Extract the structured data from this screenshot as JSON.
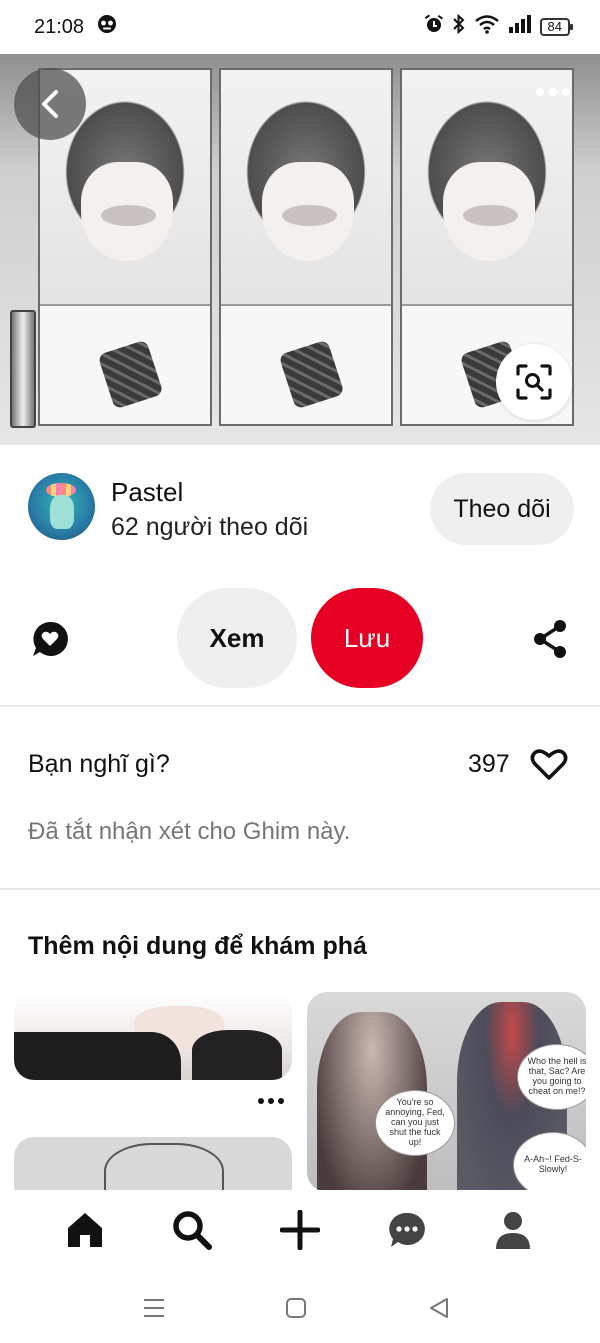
{
  "status_bar": {
    "time": "21:08",
    "battery": "84"
  },
  "creator": {
    "name": "Pastel",
    "followers": "62 người theo dõi",
    "follow_label": "Theo dõi"
  },
  "actions": {
    "view_label": "Xem",
    "save_label": "Lưu",
    "save_color": "#e60023"
  },
  "comments": {
    "prompt": "Bạn nghĩ gì?",
    "likes": "397",
    "disabled_note": "Đã tắt nhận xét cho Ghim này."
  },
  "discover": {
    "title": "Thêm nội dung để khám phá",
    "card2_bubbles": [
      "You're so annoying, Fed, can you just shut the fuck up!",
      "A-Ah~! Fed-S- Slowly!",
      "Who the hell is that, Sac? Are you going to cheat on me!?"
    ]
  },
  "bottom_nav": {
    "items": [
      "home-icon",
      "search-icon",
      "create-icon",
      "messages-icon",
      "profile-icon"
    ]
  },
  "system_nav": {
    "items": [
      "recents-icon",
      "home-button-icon",
      "back-icon"
    ]
  }
}
